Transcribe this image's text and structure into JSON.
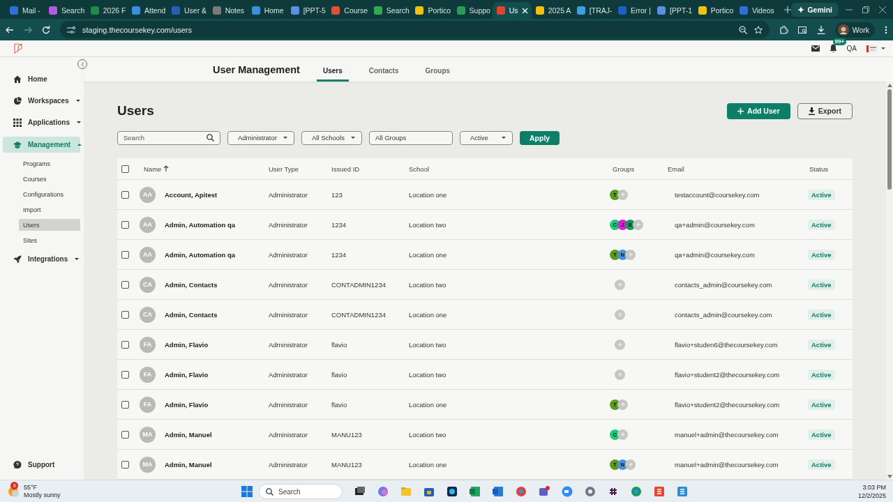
{
  "browser": {
    "tabs": [
      {
        "label": "Mail -",
        "color": "#2f6fd6",
        "selected": false
      },
      {
        "label": "Search",
        "color": "#b25be0",
        "selected": false
      },
      {
        "label": "2026 F",
        "color": "#1f8a4a",
        "selected": false
      },
      {
        "label": "Attend",
        "color": "#3a8fe0",
        "selected": false
      },
      {
        "label": "User &",
        "color": "#2a5db8",
        "selected": false
      },
      {
        "label": "Notes",
        "color": "#7a7a7a",
        "selected": false
      },
      {
        "label": "Home",
        "color": "#3a8fe0",
        "selected": false
      },
      {
        "label": "[PPT-5",
        "color": "#5b8fe0",
        "selected": false
      },
      {
        "label": "Course",
        "color": "#e0522f",
        "selected": false
      },
      {
        "label": "Search",
        "color": "#34a853",
        "selected": false
      },
      {
        "label": "Portico",
        "color": "#f2c10f",
        "selected": false
      },
      {
        "label": "Suppo",
        "color": "#2a9a55",
        "selected": false
      },
      {
        "label": "Us",
        "color": "#e2452f",
        "selected": true
      },
      {
        "label": "2025 A",
        "color": "#f2c10f",
        "selected": false
      },
      {
        "label": "[TRAJ-",
        "color": "#3aa0e0",
        "selected": false
      },
      {
        "label": "Error |",
        "color": "#1c5fc9",
        "selected": false
      },
      {
        "label": "[PPT-1",
        "color": "#5b8fe0",
        "selected": false
      },
      {
        "label": "Portico",
        "color": "#f2c10f",
        "selected": false
      },
      {
        "label": "Videos",
        "color": "#2f6fd6",
        "selected": false
      }
    ],
    "gemini": "Gemini",
    "url": "staging.thecoursekey.com/users",
    "profile": "Work"
  },
  "app_header": {
    "notification_badge": "99+",
    "user": "QA"
  },
  "sidebar": {
    "items": [
      {
        "label": "Home",
        "selected": false
      },
      {
        "label": "Workspaces",
        "selected": false,
        "expanded": false
      },
      {
        "label": "Applications",
        "selected": false,
        "expanded": false
      },
      {
        "label": "Management",
        "selected": true,
        "expanded": true,
        "children": [
          {
            "label": "Programs",
            "selected": false
          },
          {
            "label": "Courses",
            "selected": false
          },
          {
            "label": "Configurations",
            "selected": false
          },
          {
            "label": "Import",
            "selected": false
          },
          {
            "label": "Users",
            "selected": true
          },
          {
            "label": "Sites",
            "selected": false
          }
        ]
      },
      {
        "label": "Integrations",
        "selected": false,
        "expanded": false
      }
    ],
    "footer": "Support"
  },
  "subheader": {
    "title": "User Management",
    "tabs": [
      {
        "label": "Users",
        "selected": true
      },
      {
        "label": "Contacts",
        "selected": false
      },
      {
        "label": "Groups",
        "selected": false
      }
    ]
  },
  "page": {
    "title": "Users",
    "actions": [
      {
        "kind": "add",
        "label": "Add User"
      },
      {
        "kind": "export",
        "label": "Export"
      }
    ],
    "filters": [
      {
        "kind": "search",
        "placeholder": "Search"
      },
      {
        "kind": "dropdown",
        "value": "Administrator"
      },
      {
        "kind": "dropdown",
        "value": "All Schools"
      },
      {
        "kind": "field",
        "value": "All Groups"
      },
      {
        "kind": "dropdown",
        "value": "Active"
      },
      {
        "kind": "apply",
        "label": "Apply"
      }
    ]
  },
  "table": {
    "select_all_checked": false,
    "columns": [
      "Name",
      "User Type",
      "Issued ID",
      "School",
      "Groups",
      "Email",
      "Status"
    ],
    "rows": [
      {
        "checked": false,
        "initials": "AA",
        "name": "Account, Apitest",
        "user_type": "Administrator",
        "issued_id": "123",
        "school": "Location one",
        "groups": [
          {
            "letter": "T",
            "color": "#5b9a21"
          }
        ],
        "email": "testaccount@coursekey.com",
        "status": "Active"
      },
      {
        "checked": false,
        "initials": "AA",
        "name": "Admin, Automation qa",
        "user_type": "Administrator",
        "issued_id": "1234",
        "school": "Location two",
        "groups": [
          {
            "letter": "C",
            "color": "#1fc97a"
          },
          {
            "letter": "J",
            "color": "#d41fd4"
          },
          {
            "letter": "E",
            "color": "#16965a"
          }
        ],
        "email": "qa+admin@coursekey.com",
        "status": "Active"
      },
      {
        "checked": false,
        "initials": "AA",
        "name": "Admin, Automation qa",
        "user_type": "Administrator",
        "issued_id": "1234",
        "school": "Location one",
        "groups": [
          {
            "letter": "T",
            "color": "#5b9a21"
          },
          {
            "letter": "N",
            "color": "#4a90e2"
          }
        ],
        "email": "qa+admin@coursekey.com",
        "status": "Active"
      },
      {
        "checked": false,
        "initials": "CA",
        "name": "Admin, Contacts",
        "user_type": "Administrator",
        "issued_id": "CONTADMIN1234",
        "school": "Location two",
        "groups": [],
        "email": "contacts_admin@coursekey.com",
        "status": "Active"
      },
      {
        "checked": false,
        "initials": "CA",
        "name": "Admin, Contacts",
        "user_type": "Administrator",
        "issued_id": "CONTADMIN1234",
        "school": "Location one",
        "groups": [],
        "email": "contacts_admin@coursekey.com",
        "status": "Active"
      },
      {
        "checked": false,
        "initials": "FA",
        "name": "Admin, Flavio",
        "user_type": "Administrator",
        "issued_id": "flavio",
        "school": "Location two",
        "groups": [],
        "email": "flavio+studen6@thecoursekey.com",
        "status": "Active"
      },
      {
        "checked": false,
        "initials": "FA",
        "name": "Admin, Flavio",
        "user_type": "Administrator",
        "issued_id": "flavio",
        "school": "Location two",
        "groups": [],
        "email": "flavio+student2@thecoursekey.com",
        "status": "Active"
      },
      {
        "checked": false,
        "initials": "FA",
        "name": "Admin, Flavio",
        "user_type": "Administrator",
        "issued_id": "flavio",
        "school": "Location one",
        "groups": [
          {
            "letter": "T",
            "color": "#5b9a21"
          }
        ],
        "email": "flavio+student2@thecoursekey.com",
        "status": "Active"
      },
      {
        "checked": false,
        "initials": "MA",
        "name": "Admin, Manuel",
        "user_type": "Administrator",
        "issued_id": "MANU123",
        "school": "Location two",
        "groups": [
          {
            "letter": "C",
            "color": "#1fc97a"
          }
        ],
        "email": "manuel+admin@thecoursekey.com",
        "status": "Active"
      },
      {
        "checked": false,
        "initials": "MA",
        "name": "Admin, Manuel",
        "user_type": "Administrator",
        "issued_id": "MANU123",
        "school": "Location one",
        "groups": [
          {
            "letter": "T",
            "color": "#5b9a21"
          },
          {
            "letter": "N",
            "color": "#4a90e2"
          }
        ],
        "email": "manuel+admin@thecoursekey.com",
        "status": "Active"
      }
    ]
  },
  "taskbar": {
    "weather_badge": "9",
    "temperature": "55°F",
    "condition": "Mostly sunny",
    "search_placeholder": "Search",
    "time": "3:03 PM",
    "date": "12/2/2025"
  }
}
